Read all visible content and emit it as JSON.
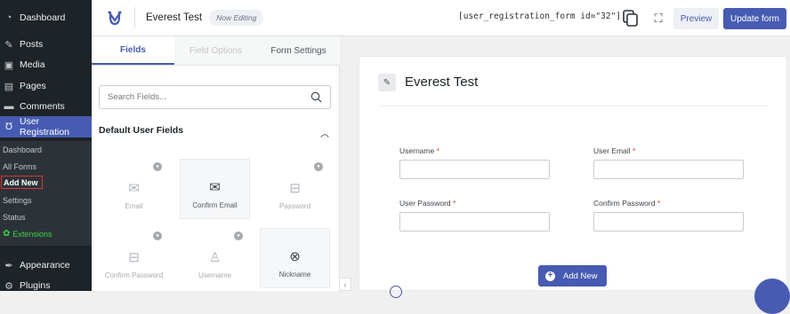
{
  "sidebar": {
    "items": [
      {
        "label": "Dashboard",
        "icon": "dashboard-icon"
      },
      {
        "label": "Posts",
        "icon": "pin-icon"
      },
      {
        "label": "Media",
        "icon": "media-icon"
      },
      {
        "label": "Pages",
        "icon": "pages-icon"
      },
      {
        "label": "Comments",
        "icon": "comments-icon"
      },
      {
        "label": "User Registration",
        "icon": "user-registration-icon"
      },
      {
        "label": "Appearance",
        "icon": "appearance-icon"
      },
      {
        "label": "Plugins",
        "icon": "plugins-icon"
      }
    ],
    "submenu": [
      {
        "label": "Dashboard"
      },
      {
        "label": "All Forms"
      },
      {
        "label": "Add New"
      },
      {
        "label": "Settings"
      },
      {
        "label": "Status"
      },
      {
        "label": "Extensions"
      }
    ]
  },
  "header": {
    "title": "Everest Test",
    "badge": "Now Editing",
    "shortcode": "[user_registration_form id=\"32\"]",
    "preview": "Preview",
    "update": "Update form"
  },
  "builder": {
    "tabs": [
      "Fields",
      "Field Options",
      "Form Settings"
    ],
    "search_placeholder": "Search Fields...",
    "section_title": "Default User Fields",
    "fields": [
      {
        "label": "Email",
        "icon": "mail-icon"
      },
      {
        "label": "Confirm Email",
        "icon": "mail-check-icon"
      },
      {
        "label": "Password",
        "icon": "lock-icon"
      },
      {
        "label": "Confirm Password",
        "icon": "lock-check-icon"
      },
      {
        "label": "Username",
        "icon": "user-icon"
      },
      {
        "label": "Nickname",
        "icon": "nickname-icon"
      }
    ]
  },
  "canvas": {
    "title": "Everest Test",
    "fields": [
      {
        "label": "Username",
        "required": "*"
      },
      {
        "label": "User Email",
        "required": "*"
      },
      {
        "label": "User Password",
        "required": "*"
      },
      {
        "label": "Confirm Password",
        "required": "*"
      }
    ],
    "add_new": "Add New"
  },
  "colors": {
    "accent": "#475bb2",
    "sidebar_bg": "#1d2327",
    "required": "#e2401c",
    "extensions": "#3ed048"
  }
}
